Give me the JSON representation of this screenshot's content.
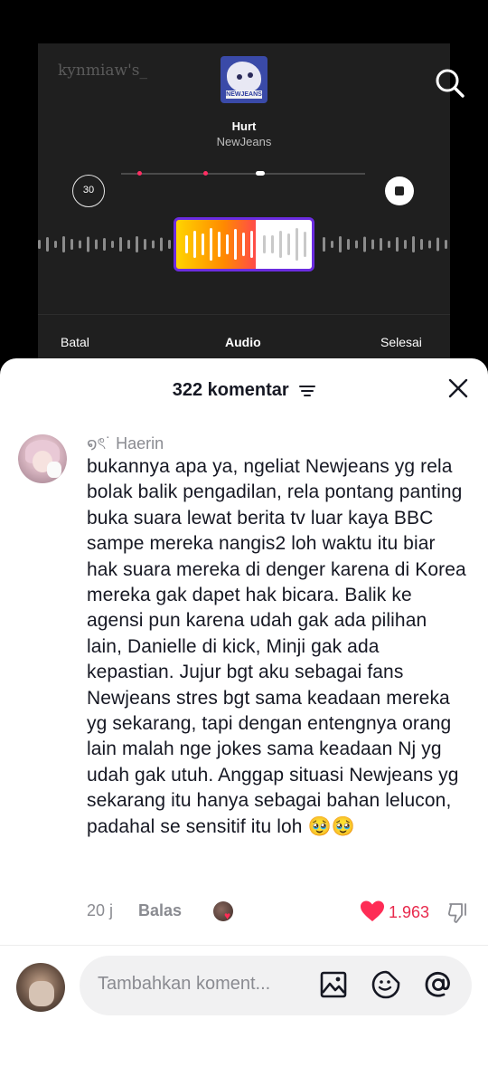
{
  "editor": {
    "watermark": "kynmiaw's_",
    "song": {
      "title": "Hurt",
      "artist": "NewJeans",
      "cover_tag": "NEWJEANS"
    },
    "timer_label": "30",
    "buttons": {
      "cancel": "Batal",
      "audio": "Audio",
      "done": "Selesai"
    }
  },
  "comments": {
    "header": "322 komentar",
    "item": {
      "username": "໑ৎ˙ Haerin",
      "text": "bukannya apa ya, ngeliat Newjeans yg rela bolak balik pengadilan, rela pontang panting buka suara lewat berita tv luar kaya BBC sampe mereka nangis2 loh waktu itu biar hak suara mereka di denger karena di Korea mereka gak dapet hak bicara. Balik ke agensi pun karena udah gak ada pilihan lain, Danielle di kick, Minji gak ada kepastian. Jujur bgt aku sebagai fans Newjeans stres bgt sama keadaan mereka yg sekarang, tapi dengan entengnya orang lain malah nge jokes sama keadaan Nj yg udah gak utuh. Anggap situasi Newjeans yg sekarang itu hanya sebagai bahan lelucon, padahal se sensitif itu loh 🥹🥹",
      "time": "20 j",
      "reply_label": "Balas",
      "like_count": "1.963"
    },
    "input": {
      "placeholder": "Tambahkan koment..."
    }
  },
  "colors": {
    "accent": "#fe2c55",
    "like": "#e8294c",
    "selector_border": "#6b2ce0"
  },
  "icons": [
    "search-icon",
    "stop-icon",
    "filter-icon",
    "close-icon",
    "heart-icon",
    "dislike-icon",
    "image-icon",
    "emoji-icon",
    "mention-icon"
  ]
}
